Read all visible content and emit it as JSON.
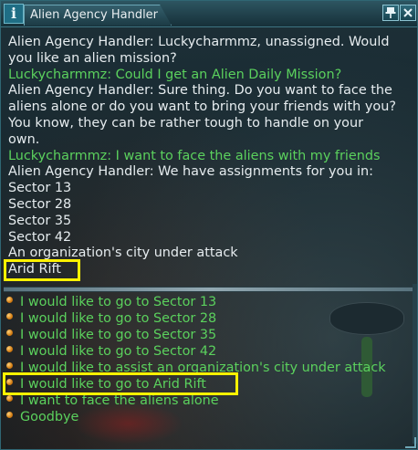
{
  "window": {
    "title": "Alien Agency Handler",
    "info_glyph": "i",
    "pin_glyph": "📌",
    "close_glyph": "✕"
  },
  "conversation": [
    {
      "text": "Alien Agency Handler: Luckycharmmz, unassigned. Would",
      "speaker": "npc"
    },
    {
      "text": "you like an alien mission?",
      "speaker": "npc"
    },
    {
      "text": "Luckycharmmz: Could I get an Alien Daily Mission?",
      "speaker": "player"
    },
    {
      "text": "Alien Agency Handler: Sure thing. Do you want to face the",
      "speaker": "npc"
    },
    {
      "text": "aliens alone or do you want to bring your friends with you?",
      "speaker": "npc"
    },
    {
      "text": "You know, they can be rather tough to handle on your",
      "speaker": "npc"
    },
    {
      "text": "own.",
      "speaker": "npc"
    },
    {
      "text": "Luckycharmmz: I want to face the aliens with my friends",
      "speaker": "player"
    },
    {
      "text": "Alien Agency Handler: We have assignments for you in:",
      "speaker": "npc"
    },
    {
      "text": "Sector 13",
      "speaker": "npc"
    },
    {
      "text": "Sector 28",
      "speaker": "npc"
    },
    {
      "text": "Sector 35",
      "speaker": "npc"
    },
    {
      "text": "Sector 42",
      "speaker": "npc"
    },
    {
      "text": "An organization's city under attack",
      "speaker": "npc"
    },
    {
      "text": "Arid Rift",
      "speaker": "npc"
    }
  ],
  "options": [
    {
      "label": "I would like to go to Sector 13"
    },
    {
      "label": "I would like to go to Sector 28"
    },
    {
      "label": "I would like to go to Sector 35"
    },
    {
      "label": "I would like to go to Sector 42"
    },
    {
      "label": "I would like to assist an organization's city under attack"
    },
    {
      "label": "I would like to go to Arid Rift"
    },
    {
      "label": "I want to face the aliens alone"
    },
    {
      "label": "Goodbye"
    }
  ],
  "colors": {
    "npc_text": "#e6ecef",
    "player_text": "#5bd15d",
    "highlight": "#fff200",
    "bullet": "#e08a18"
  },
  "icons": [
    "info-icon",
    "pin-icon",
    "close-icon",
    "bullet-icon",
    "resize-grip-icon"
  ]
}
